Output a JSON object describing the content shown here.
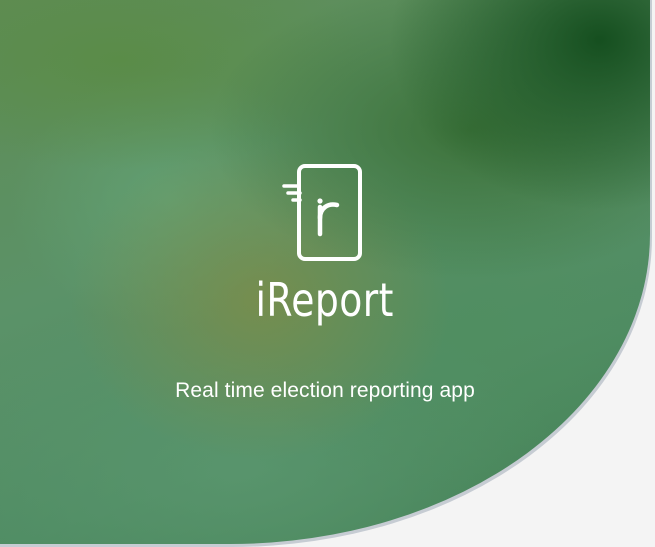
{
  "splash": {
    "app_name": "iReport",
    "tagline": "Real time election reporting app",
    "logo_icon": "phone-r-icon"
  },
  "colors": {
    "hero_green_dark": "#124c1c",
    "hero_green": "#5b9268",
    "text": "#ffffff",
    "page_background": "#f4f4f4"
  }
}
